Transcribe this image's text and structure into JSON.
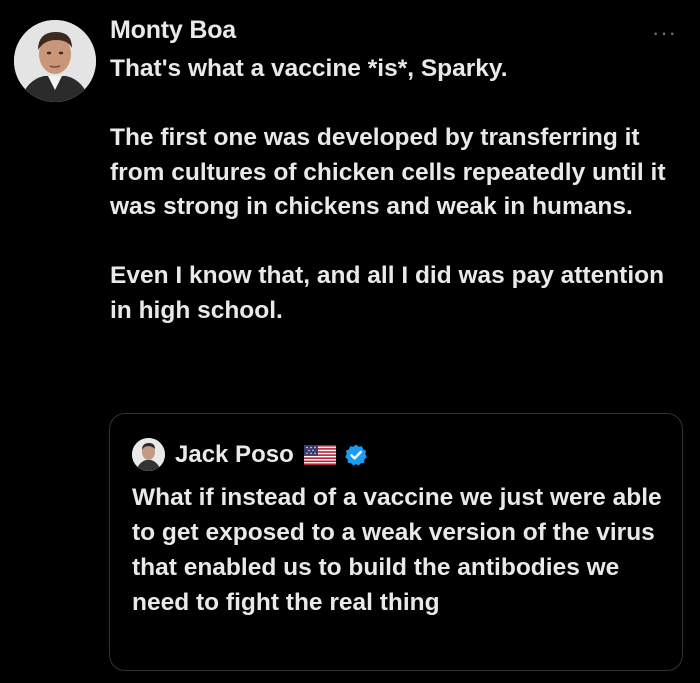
{
  "tweet": {
    "author_name": "Monty Boa",
    "more_label": "···",
    "paragraphs": [
      "That's what a vaccine *is*, Sparky.",
      "The first one was developed by transferring it from cultures of chicken cells repeatedly until it was strong in chickens and weak in humans.",
      "Even I know that, and all I did was pay attention in high school."
    ]
  },
  "quoted_tweet": {
    "author_name": "Jack Poso",
    "flag_icon": "us-flag-icon",
    "verified_icon": "verified-badge-icon",
    "text": "What if instead of a vaccine we just were able to get exposed to a weak version of the virus that enabled us to build the antibodies we need to fight the real thing"
  },
  "colors": {
    "background": "#000000",
    "text": "#e7e9ea",
    "muted": "#71767b",
    "border": "#2f3336",
    "verified": "#1d9bf0"
  }
}
